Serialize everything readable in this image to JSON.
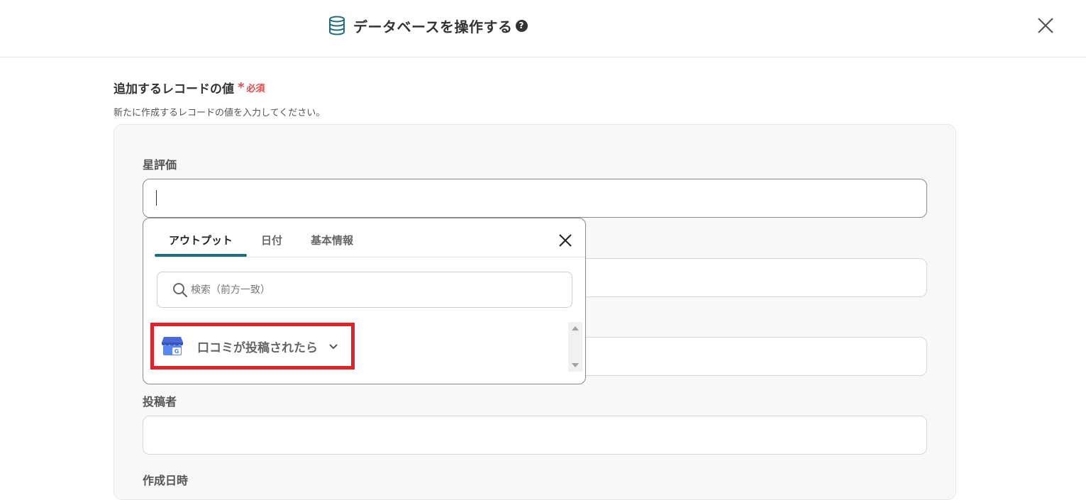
{
  "header": {
    "title": "データベースを操作する",
    "help_glyph": "?",
    "icons": {
      "title": "database-icon",
      "help": "question-circle-icon",
      "close": "close-icon"
    }
  },
  "section": {
    "label": "追加するレコードの値",
    "asterisk": "*",
    "required": "必須",
    "description": "新たに作成するレコードの値を入力してください。"
  },
  "fields": [
    {
      "label": "星評価",
      "value": ""
    },
    {
      "label": "",
      "value": ""
    },
    {
      "label": "",
      "value": ""
    },
    {
      "label": "投稿者",
      "value": ""
    },
    {
      "label": "作成日時",
      "value": ""
    }
  ],
  "dropdown": {
    "tabs": [
      {
        "label": "アウトプット",
        "active": true
      },
      {
        "label": "日付",
        "active": false
      },
      {
        "label": "基本情報",
        "active": false
      }
    ],
    "search": {
      "placeholder": "検索（前方一致）",
      "value": ""
    },
    "items": [
      {
        "label": "口コミが投稿されたら",
        "icon": "google-my-business-icon",
        "expand_icon": "chevron-down-icon"
      }
    ]
  },
  "colors": {
    "accent": "#1f6e7e",
    "required": "#e5484d",
    "highlight": "#e0222a"
  }
}
